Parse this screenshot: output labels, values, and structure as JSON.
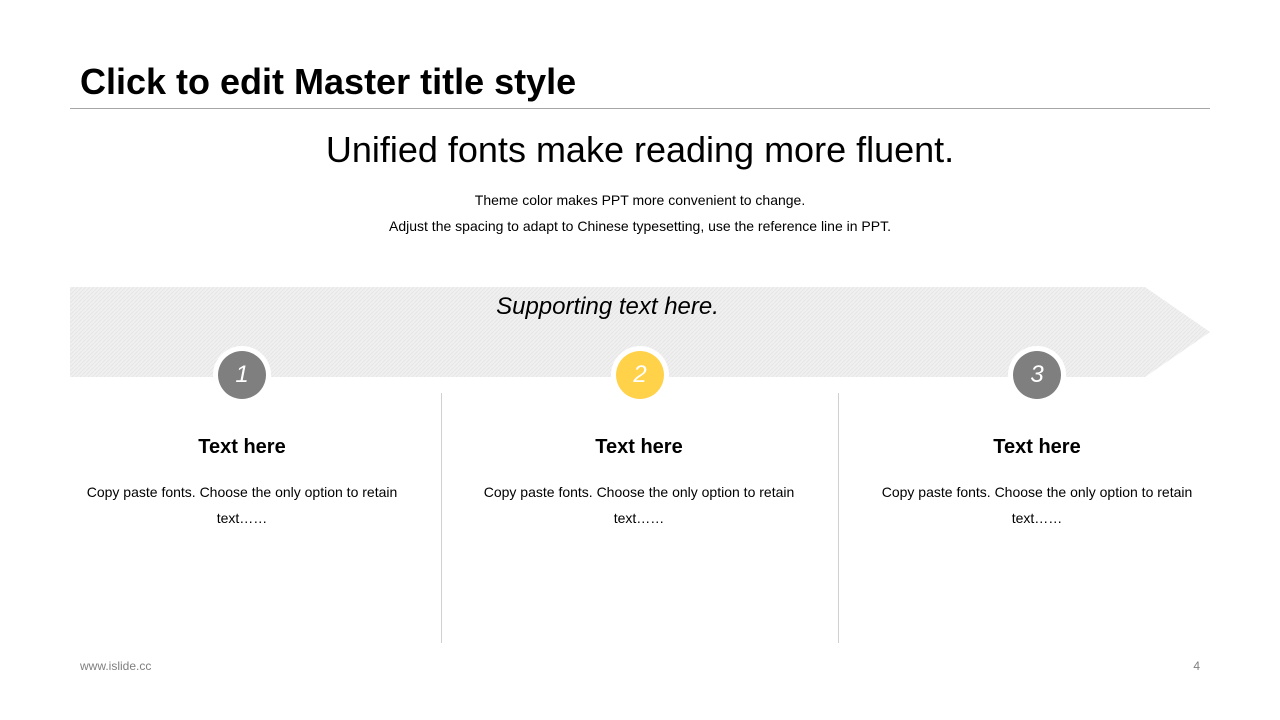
{
  "slide": {
    "title": "Click to edit Master title style",
    "headline": "Unified fonts make reading more fluent.",
    "subtitle_lines": [
      "Theme color makes PPT more convenient  to change.",
      "Adjust  the spacing to adapt to Chinese  typesetting,  use the reference line  in PPT."
    ],
    "supporting_text": "Supporting text here."
  },
  "steps": [
    {
      "number": "1",
      "color": "#7f7f7f",
      "heading": "Text here",
      "body": "Copy paste fonts. Choose the only  option to retain text……"
    },
    {
      "number": "2",
      "color": "#ffd24a",
      "heading": "Text here",
      "body": "Copy paste fonts. Choose the only  option to retain text……"
    },
    {
      "number": "3",
      "color": "#7f7f7f",
      "heading": "Text here",
      "body": "Copy paste fonts. Choose the only  option to retain text……"
    }
  ],
  "colors": {
    "band": "#f0f0f0",
    "accent": "#ffd24a",
    "neutral": "#7f7f7f"
  },
  "footer": {
    "website": "www.islide.cc",
    "page_number": "4"
  }
}
